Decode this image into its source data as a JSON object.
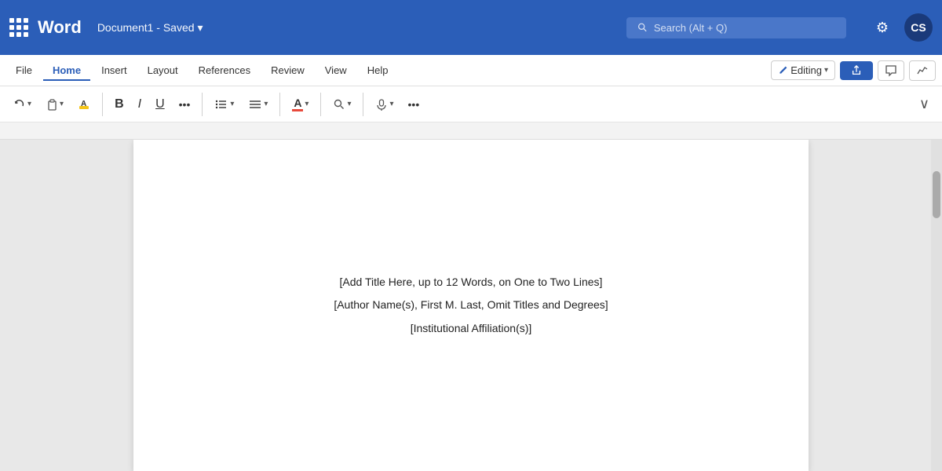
{
  "app": {
    "name": "Word",
    "grid_icon": "apps-icon"
  },
  "titlebar": {
    "doc_title": "Document1  -  Saved",
    "doc_title_arrow": "▾",
    "search_placeholder": "Search (Alt + Q)",
    "settings_icon": "⚙",
    "avatar_text": "CS"
  },
  "menubar": {
    "items": [
      {
        "label": "File",
        "active": false
      },
      {
        "label": "Home",
        "active": true
      },
      {
        "label": "Insert",
        "active": false
      },
      {
        "label": "Layout",
        "active": false
      },
      {
        "label": "References",
        "active": false
      },
      {
        "label": "Review",
        "active": false
      },
      {
        "label": "View",
        "active": false
      },
      {
        "label": "Help",
        "active": false
      }
    ],
    "edit_label": "Editing",
    "share_icon": "↗",
    "comment_icon": "💬",
    "chart_icon": "📈"
  },
  "toolbar": {
    "undo_label": "↺",
    "clipboard_label": "📋",
    "format_painter": "🖌",
    "bold": "B",
    "italic": "I",
    "underline": "U",
    "more_label": "•••",
    "bullets_label": "☰",
    "align_label": "≡",
    "font_color_label": "A",
    "find_label": "🔍",
    "mic_label": "🎤",
    "more2_label": "•••",
    "expand_label": "∨"
  },
  "document": {
    "lines": [
      "[Add Title Here, up to 12 Words, on One to Two Lines]",
      "[Author Name(s), First M. Last, Omit Titles and Degrees]",
      "[Institutional Affiliation(s)]"
    ]
  }
}
